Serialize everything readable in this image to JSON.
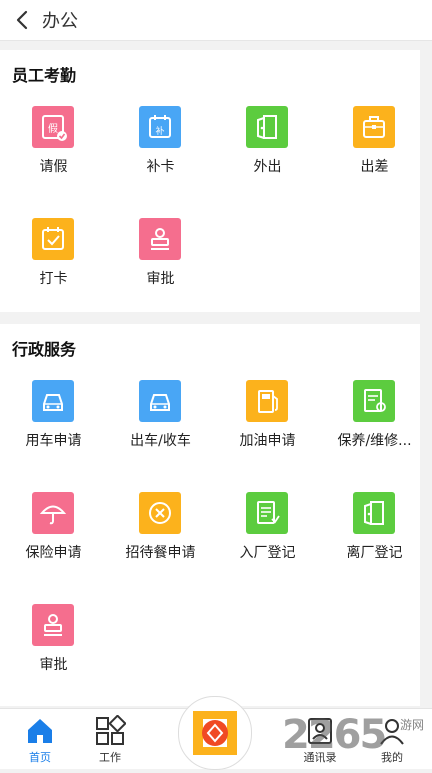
{
  "header": {
    "title": "办公"
  },
  "sections": [
    {
      "title": "员工考勤",
      "items": [
        {
          "label": "请假",
          "icon": "leave-icon"
        },
        {
          "label": "补卡",
          "icon": "calendar-icon"
        },
        {
          "label": "外出",
          "icon": "door-exit-icon"
        },
        {
          "label": "出差",
          "icon": "briefcase-icon"
        },
        {
          "label": "打卡",
          "icon": "calendar-check-icon"
        },
        {
          "label": "审批",
          "icon": "stamp-icon"
        }
      ]
    },
    {
      "title": "行政服务",
      "items": [
        {
          "label": "用车申请",
          "icon": "car-icon"
        },
        {
          "label": "出车/收车",
          "icon": "car-icon"
        },
        {
          "label": "加油申请",
          "icon": "fuel-icon"
        },
        {
          "label": "保养/维修...",
          "icon": "repair-doc-icon"
        },
        {
          "label": "保险申请",
          "icon": "umbrella-icon"
        },
        {
          "label": "招待餐申请",
          "icon": "dining-icon"
        },
        {
          "label": "入厂登记",
          "icon": "checklist-icon"
        },
        {
          "label": "离厂登记",
          "icon": "door-exit-icon"
        },
        {
          "label": "审批",
          "icon": "stamp-icon"
        }
      ]
    }
  ],
  "tabbar": {
    "home": "首页",
    "work": "工作",
    "contacts": "通讯录",
    "mine": "我的"
  },
  "watermark": {
    "number": "2265",
    "site": "游网"
  },
  "colors": {
    "active_tab": "#1a7ee8",
    "pink": "#f56e8e",
    "blue": "#49a6f5",
    "green": "#5ccc3f",
    "orange": "#fcb21c"
  }
}
